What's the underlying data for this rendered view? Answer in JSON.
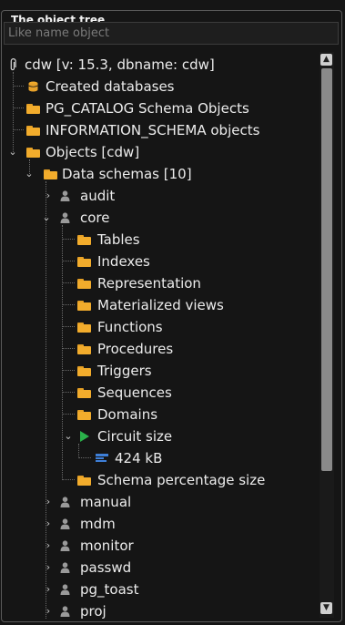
{
  "panel": {
    "title": "The object tree",
    "search_placeholder": "Like name object"
  },
  "tree": {
    "root": "cdw [v: 15.3, dbname: cdw]",
    "created_databases": "Created databases",
    "pg_catalog": "PG_CATALOG Schema Objects",
    "information_schema": "INFORMATION_SCHEMA objects",
    "objects": "Objects [cdw]",
    "data_schemas": "Data schemas [10]",
    "schema_audit": "audit",
    "schema_core": "core",
    "core_children": {
      "tables": "Tables",
      "indexes": "Indexes",
      "representation": "Representation",
      "materialized_views": "Materialized views",
      "functions": "Functions",
      "procedures": "Procedures",
      "triggers": "Triggers",
      "sequences": "Sequences",
      "domains": "Domains",
      "circuit_size": "Circuit size",
      "circuit_size_value": "424 kB",
      "schema_percentage_size": "Schema percentage size"
    },
    "schema_manual": "manual",
    "schema_mdm": "mdm",
    "schema_monitor": "monitor",
    "schema_passwd": "passwd",
    "schema_pg_toast": "pg_toast",
    "schema_proj": "proj"
  },
  "icons": {
    "root": "paperclip-icon",
    "database": "database-icon",
    "folder": "folder-open-icon",
    "schema": "user-icon",
    "play": "play-icon",
    "bar": "bar-chart-icon"
  },
  "colors": {
    "folder": "#f2ac2c",
    "play": "#2ab14a",
    "bar": "#3e7fd8",
    "background": "#151515"
  }
}
